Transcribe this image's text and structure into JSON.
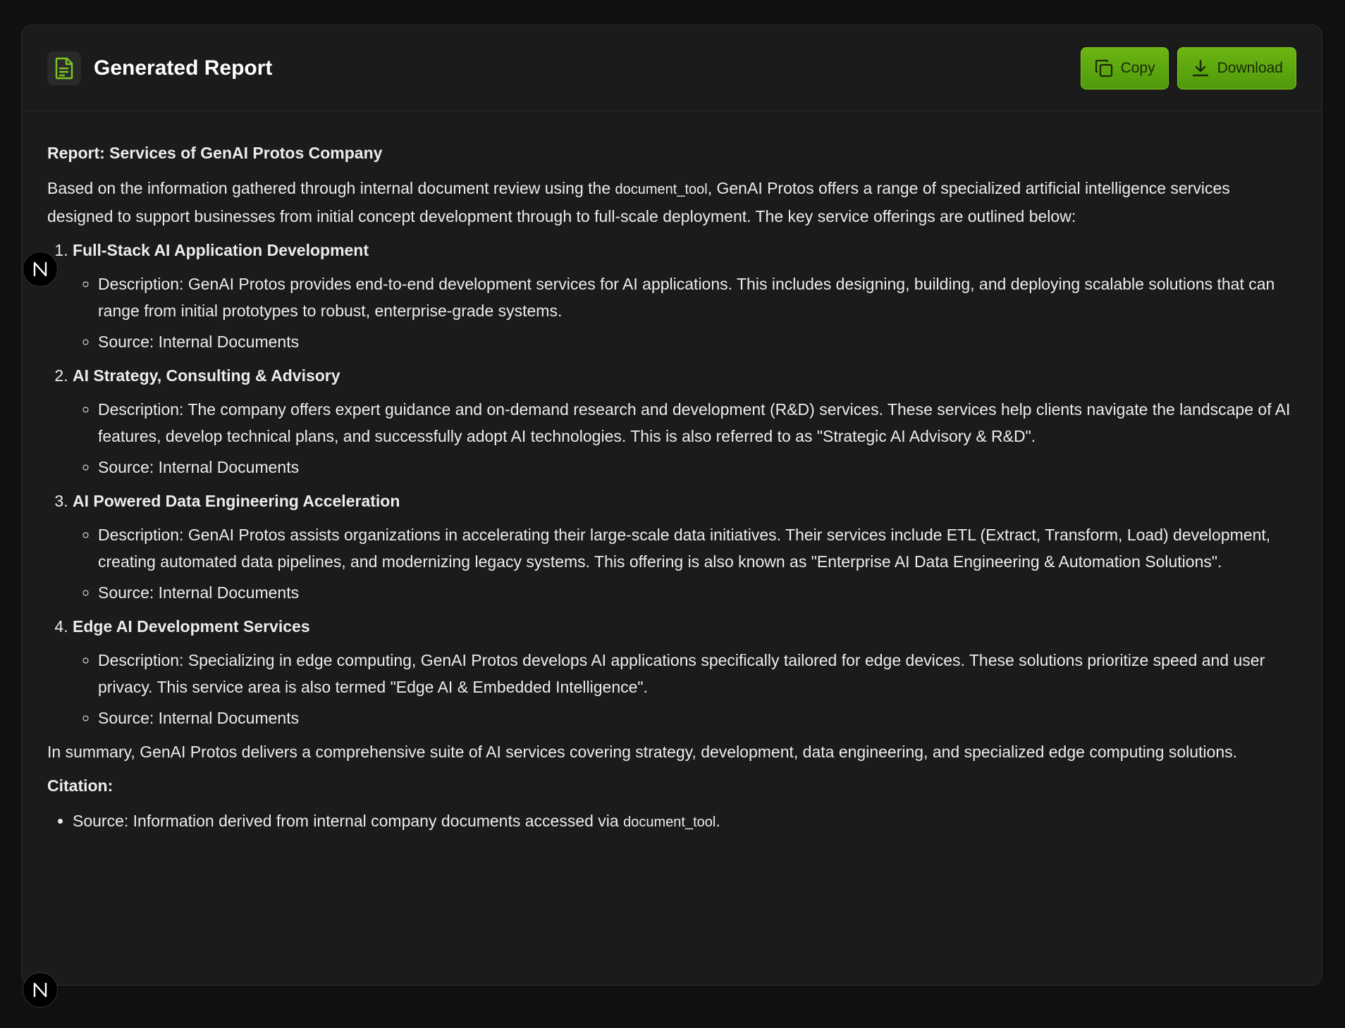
{
  "header": {
    "title": "Generated Report",
    "copy_label": "Copy",
    "download_label": "Download"
  },
  "report": {
    "title": "Report: Services of GenAI Protos Company",
    "intro_before": "Based on the information gathered through internal document review using the ",
    "intro_code": "document_tool",
    "intro_after": ", GenAI Protos offers a range of specialized artificial intelligence services designed to support businesses from initial concept development through to full-scale deployment. The key service offerings are outlined below:",
    "services": [
      {
        "title": "Full-Stack AI Application Development",
        "description": "Description: GenAI Protos provides end-to-end development services for AI applications. This includes designing, building, and deploying scalable solutions that can range from initial prototypes to robust, enterprise-grade systems.",
        "source": "Source: Internal Documents"
      },
      {
        "title": "AI Strategy, Consulting & Advisory",
        "description": "Description: The company offers expert guidance and on-demand research and development (R&D) services. These services help clients navigate the landscape of AI features, develop technical plans, and successfully adopt AI technologies. This is also referred to as \"Strategic AI Advisory & R&D\".",
        "source": "Source: Internal Documents"
      },
      {
        "title": "AI Powered Data Engineering Acceleration",
        "description": "Description: GenAI Protos assists organizations in accelerating their large-scale data initiatives. Their services include ETL (Extract, Transform, Load) development, creating automated data pipelines, and modernizing legacy systems. This offering is also known as \"Enterprise AI Data Engineering & Automation Solutions\".",
        "source": "Source: Internal Documents"
      },
      {
        "title": "Edge AI Development Services",
        "description": "Description: Specializing in edge computing, GenAI Protos develops AI applications specifically tailored for edge devices. These solutions prioritize speed and user privacy. This service area is also termed \"Edge AI & Embedded Intelligence\".",
        "source": "Source: Internal Documents"
      }
    ],
    "summary": "In summary, GenAI Protos delivers a comprehensive suite of AI services covering strategy, development, data engineering, and specialized edge computing solutions.",
    "citation_title": "Citation:",
    "citation_before": "Source: Information derived from internal company documents accessed via ",
    "citation_code": "document_tool",
    "citation_after": "."
  },
  "badges": {
    "letter": "N"
  },
  "colors": {
    "accent": "#5fa80f",
    "panel_bg": "#1b1b1b",
    "page_bg": "#0f1010"
  },
  "icons": {
    "header": "document-icon",
    "copy": "copy-icon",
    "download": "download-icon"
  }
}
